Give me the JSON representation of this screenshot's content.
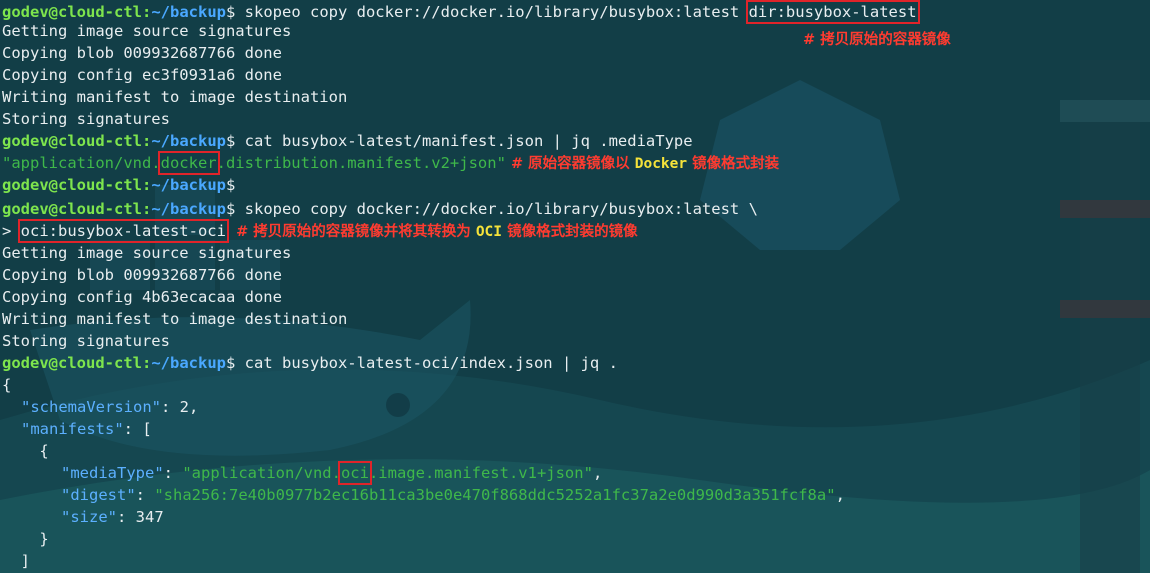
{
  "prompt": {
    "user_host": "godev@cloud-ctl",
    "sep": ":",
    "path": "~/backup",
    "dollar": "$"
  },
  "lines": {
    "l1_cmd": " skopeo copy docker://docker.io/library/busybox:latest ",
    "l1_dest": "dir:busybox-latest",
    "l1_note": "# 拷贝原始的容器镜像",
    "l2": "Getting image source signatures",
    "l3": "Copying blob 009932687766 done",
    "l4": "Copying config ec3f0931a6 done",
    "l5": "Writing manifest to image destination",
    "l6": "Storing signatures",
    "l7_cmd": " cat busybox-latest/manifest.json | jq .mediaType",
    "l8_pre": "\"application/vnd.",
    "l8_box": "docker",
    "l8_post": ".distribution.manifest.v2+json\"",
    "l8_note_a": " # 原始容器镜像以 ",
    "l8_note_b": "Docker",
    "l8_note_c": " 镜像格式封装",
    "l10_cmd": " skopeo copy docker://docker.io/library/busybox:latest \\",
    "l11_gt": "> ",
    "l11_dest": "oci:busybox-latest-oci",
    "l11_note_a": "  # 拷贝原始的容器镜像并将其转换为 ",
    "l11_note_b": "OCI",
    "l11_note_c": " 镜像格式封装的镜像",
    "l12": "Getting image source signatures",
    "l13": "Copying blob 009932687766 done",
    "l14": "Copying config 4b63ecacaa done",
    "l15": "Writing manifest to image destination",
    "l16": "Storing signatures",
    "l17_cmd": " cat busybox-latest-oci/index.json | jq .",
    "l18": "{",
    "l19_key": "\"schemaVersion\"",
    "l19_rest": ": 2,",
    "l20_key": "\"manifests\"",
    "l20_rest": ": [",
    "l21": "    {",
    "l22_key": "\"mediaType\"",
    "l22_colon": ": ",
    "l22_pre": "\"application/vnd.",
    "l22_box": "oci",
    "l22_post": ".image.manifest.v1+json\"",
    "l22_comma": ",",
    "l23_key": "\"digest\"",
    "l23_colon": ": ",
    "l23_val": "\"sha256:7e40b0977b2ec16b11ca3be0e470f868ddc5252a1fc37a2e0d990d3a351fcf8a\"",
    "l23_comma": ",",
    "l24_key": "\"size\"",
    "l24_rest": ": 347",
    "l25": "    }",
    "l26": "  ]"
  },
  "colors": {
    "background": "#123e47",
    "prompt_user": "#7ee54d",
    "prompt_path": "#4aa8ff",
    "json_key": "#5cb0ff",
    "json_string": "#3fb84a",
    "annotation_red": "#ff3b30",
    "annotation_yellow": "#f5e33a",
    "highlight_box": "#e0242a"
  }
}
